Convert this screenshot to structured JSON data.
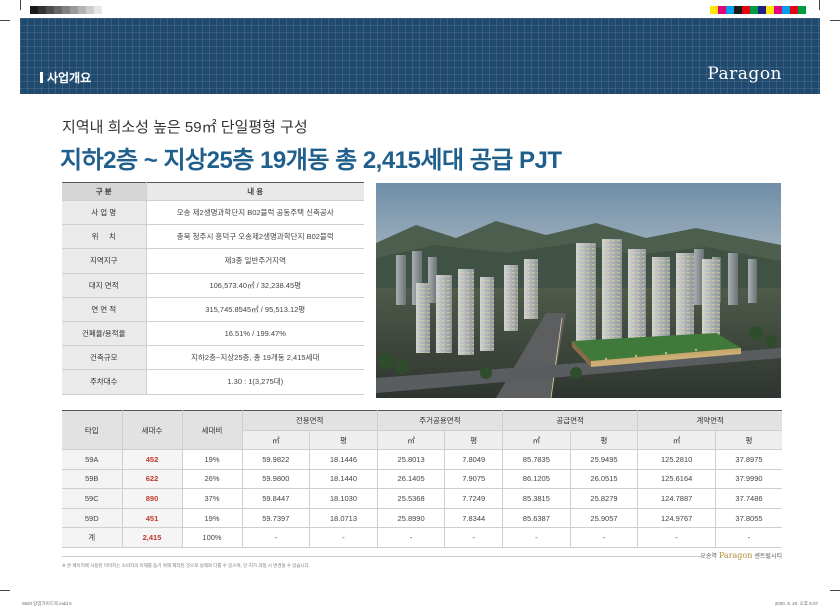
{
  "print_marks": {
    "left_swatches": [
      "#1a1a1a",
      "#333333",
      "#4d4d4d",
      "#666666",
      "#808080",
      "#999999",
      "#b3b3b3",
      "#cccccc",
      "#e6e6e6",
      "#ffffff"
    ],
    "right_swatches": [
      "#ffe600",
      "#e4007f",
      "#00a0e9",
      "#1a1a1a",
      "#e60012",
      "#009944",
      "#1d2088",
      "#ffe600",
      "#e4007f",
      "#00a0e9",
      "#e60012",
      "#009944"
    ]
  },
  "header": {
    "section_title": "사업개요",
    "logo": "Paragon",
    "background_color": "#1f4a6e"
  },
  "subtitle": "지역내 희소성 높은 59㎡ 단일평형 구성",
  "headline": "지하2층 ~ 지상25층 19개동 총 2,415세대 공급 PJT",
  "overview": {
    "header": {
      "key": "구 분",
      "value": "내 용"
    },
    "rows": [
      {
        "key": "사 업 명",
        "value": "오송 제2생명과학단지 B02블럭 공동주택 신축공사"
      },
      {
        "key": "위     치",
        "value": "충북 청주시 흥덕구 오송제2생명과학단지 B02블럭"
      },
      {
        "key": "지역지구",
        "value": "제3종 일반주거지역"
      },
      {
        "key": "대지 면적",
        "value": "106,573.40㎡ / 32,238.45평"
      },
      {
        "key": "연 면 적",
        "value": "315,745.8545㎡ / 95,513.12평"
      },
      {
        "key": "건폐율/용적율",
        "value": "16.51% / 199.47%"
      },
      {
        "key": "건축규모",
        "value": "지하2층~지상25층, 총 19개동 2,415세대"
      },
      {
        "key": "주차대수",
        "value": "1.30 : 1(3,275대)"
      }
    ]
  },
  "units": {
    "headers": {
      "type": "타입",
      "households": "세대수",
      "ratio": "세대비",
      "exclusive": "전용면적",
      "shared": "주거공용면적",
      "supply": "공급면적",
      "contract": "계약면적",
      "sqm": "㎡",
      "pyeong": "평"
    },
    "rows": [
      {
        "type": "59A",
        "households": "452",
        "ratio": "19%",
        "ex_m": "59.9822",
        "ex_p": "18.1446",
        "sh_m": "25.8013",
        "sh_p": "7.8049",
        "su_m": "85.7835",
        "su_p": "25.9495",
        "co_m": "125.2810",
        "co_p": "37.8975"
      },
      {
        "type": "59B",
        "households": "622",
        "ratio": "26%",
        "ex_m": "59.9800",
        "ex_p": "18.1440",
        "sh_m": "26.1405",
        "sh_p": "7.9075",
        "su_m": "86.1205",
        "su_p": "26.0515",
        "co_m": "125.6164",
        "co_p": "37.9990"
      },
      {
        "type": "59C",
        "households": "890",
        "ratio": "37%",
        "ex_m": "59.8447",
        "ex_p": "18.1030",
        "sh_m": "25.5368",
        "sh_p": "7.7249",
        "su_m": "85.3815",
        "su_p": "25.8279",
        "co_m": "124.7887",
        "co_p": "37.7486"
      },
      {
        "type": "59D",
        "households": "451",
        "ratio": "19%",
        "ex_m": "59.7397",
        "ex_p": "18.0713",
        "sh_m": "25.8990",
        "sh_p": "7.8344",
        "su_m": "85.6387",
        "su_p": "25.9057",
        "co_m": "124.9767",
        "co_p": "37.8055"
      },
      {
        "type": "계",
        "households": "2,415",
        "ratio": "100%",
        "ex_m": "-",
        "ex_p": "-",
        "sh_m": "-",
        "sh_p": "-",
        "su_m": "-",
        "su_p": "-",
        "co_m": "-",
        "co_p": "-"
      }
    ],
    "highlight_color": "#c0392b"
  },
  "footnote": "※ 본 페이지에 사용된 이미지는 소비자의 이해를 돕기 위해 제작된 것으로 실제와 다를 수 있으며, 인·허가 과정 시 변경될 수 있습니다.",
  "brand_footer": {
    "prefix": "오송역",
    "brand": "Paragon",
    "suffix": "센트럴시티"
  },
  "file_info": "0820 당업가이드북.indd   6",
  "date_info": "2020. 8. 20.  오후 6:37"
}
